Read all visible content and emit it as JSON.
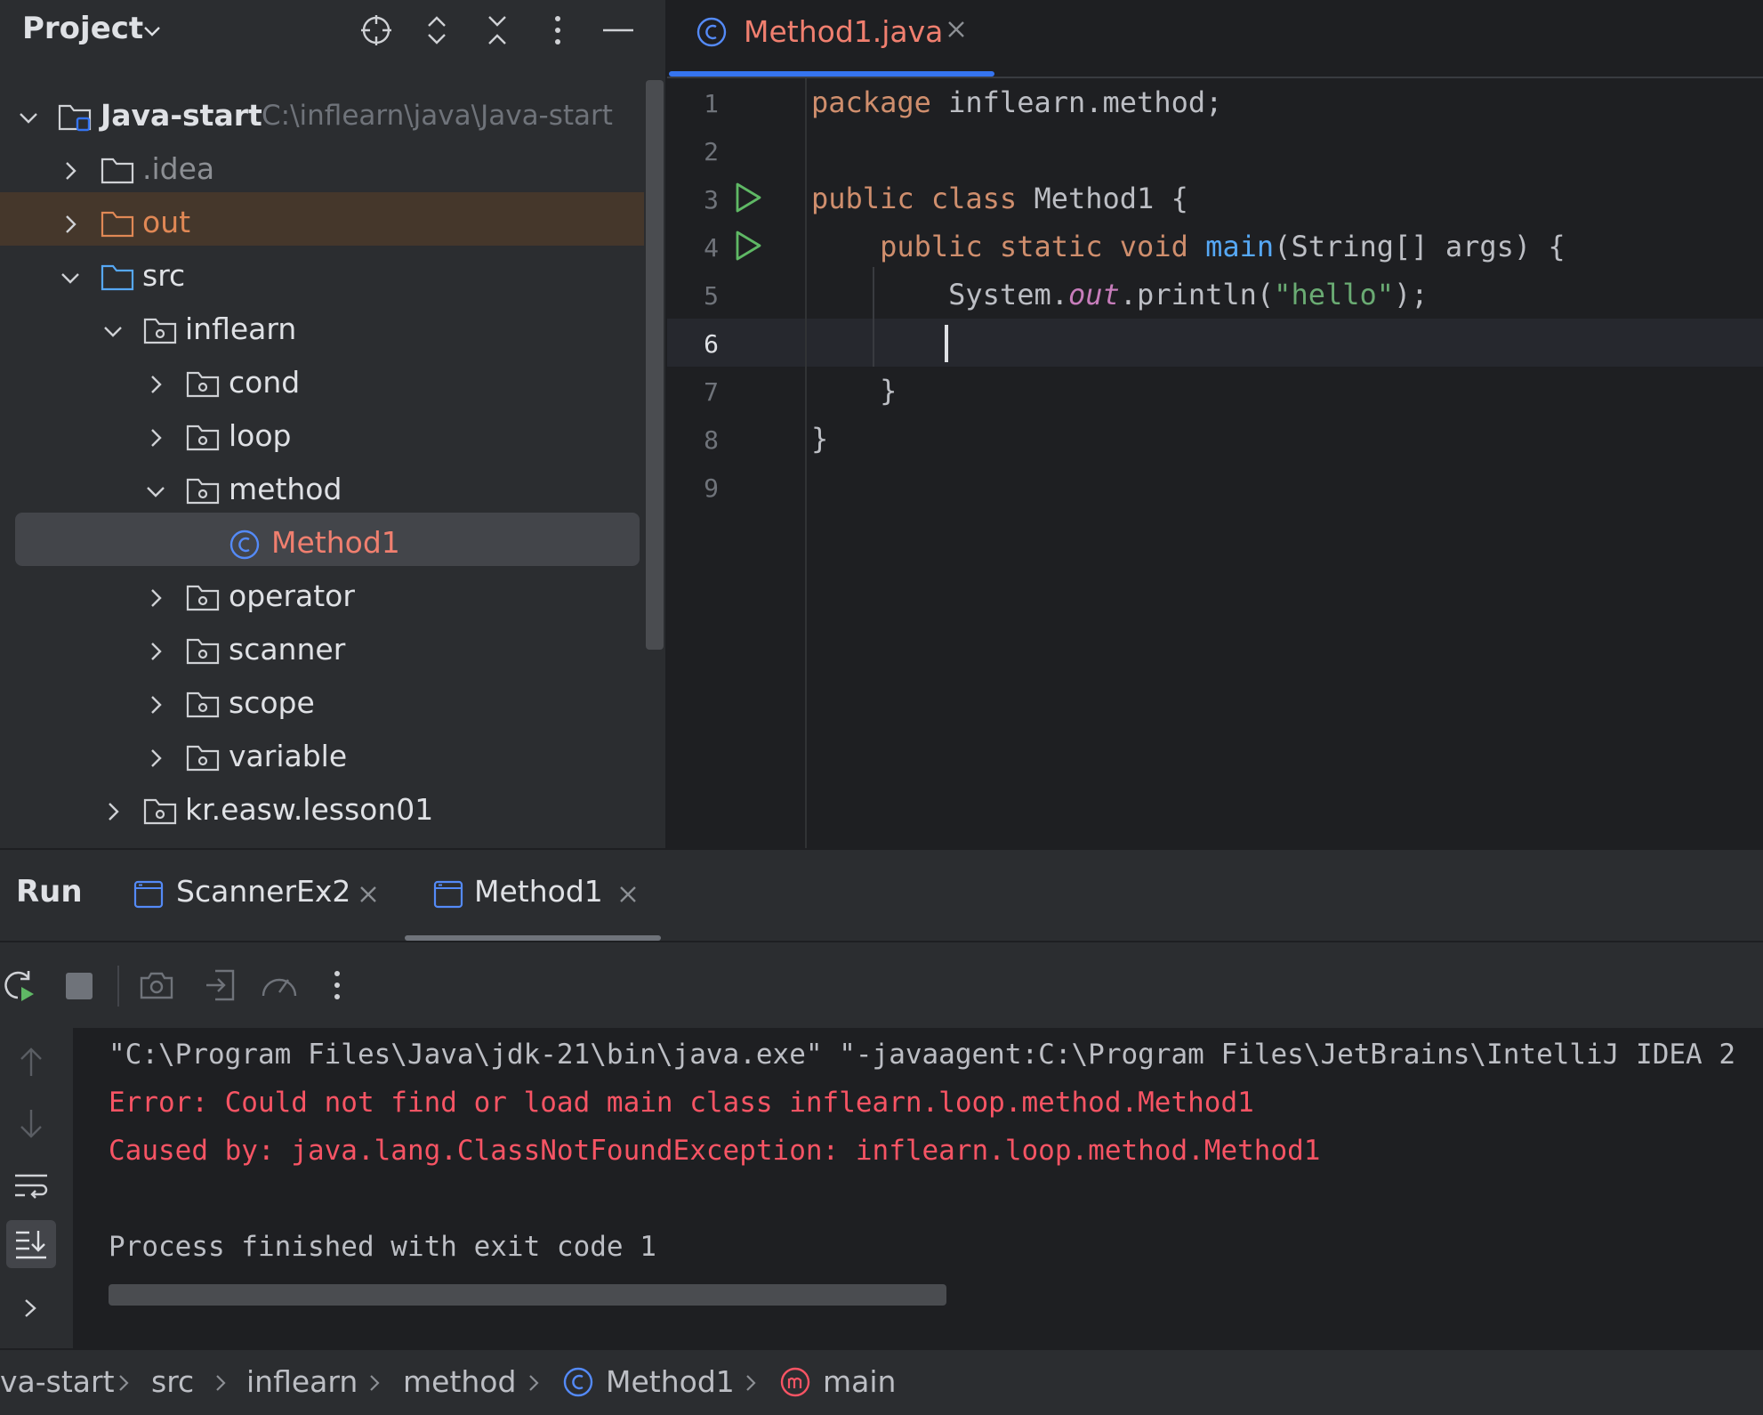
{
  "project_panel": {
    "title": "Project",
    "tree": [
      {
        "label": "Java-start",
        "path": "C:\\inflearn\\java\\Java-start"
      },
      {
        "label": ".idea"
      },
      {
        "label": "out"
      },
      {
        "label": "src"
      },
      {
        "label": "inflearn"
      },
      {
        "label": "cond"
      },
      {
        "label": "loop"
      },
      {
        "label": "method"
      },
      {
        "label": "Method1"
      },
      {
        "label": "operator"
      },
      {
        "label": "scanner"
      },
      {
        "label": "scope"
      },
      {
        "label": "variable"
      },
      {
        "label": "kr.easw.lesson01"
      }
    ]
  },
  "editor": {
    "tab_label": "Method1.java",
    "line_numbers": [
      "1",
      "2",
      "3",
      "4",
      "5",
      "6",
      "7",
      "8",
      "9"
    ],
    "code": {
      "l1_kw": "package",
      "l1_rest": " inflearn.method;",
      "l3_kw": "public class",
      "l3_rest": " Method1 {",
      "l4_kw": "    public static void",
      "l4_fn": " main",
      "l4_rest": "(String[] args) {",
      "l5_a": "        System.",
      "l5_field": "out",
      "l5_b": ".println(",
      "l5_str": "\"hello\"",
      "l5_c": ");",
      "l7": "    }",
      "l8": "}"
    }
  },
  "run_panel": {
    "title": "Run",
    "tabs": [
      {
        "label": "ScannerEx2"
      },
      {
        "label": "Method1"
      }
    ],
    "console": [
      "\"C:\\Program Files\\Java\\jdk-21\\bin\\java.exe\" \"-javaagent:C:\\Program Files\\JetBrains\\IntelliJ IDEA 2",
      "Error: Could not find or load main class inflearn.loop.method.Method1",
      "Caused by: java.lang.ClassNotFoundException: inflearn.loop.method.Method1",
      "Process finished with exit code 1"
    ]
  },
  "breadcrumb": [
    "va-start",
    "src",
    "inflearn",
    "method",
    "Method1",
    "main"
  ],
  "colors": {
    "accent": "#3574f0",
    "error": "#f75464",
    "keyword": "#cf8e6d",
    "string": "#6aab73",
    "function": "#56a8f5",
    "class_file": "#f07f6f",
    "run_green": "#5fb865"
  },
  "icons": [
    "locate-icon",
    "expand-all-icon",
    "collapse-all-icon",
    "more-icon",
    "minimize-icon",
    "folder-icon",
    "package-icon",
    "class-icon",
    "run-gutter-icon",
    "rerun-icon",
    "stop-icon",
    "screenshot-icon",
    "import-icon",
    "profiler-icon",
    "scroll-up-icon",
    "scroll-down-icon",
    "soft-wrap-icon",
    "scroll-to-end-icon",
    "method-icon"
  ]
}
